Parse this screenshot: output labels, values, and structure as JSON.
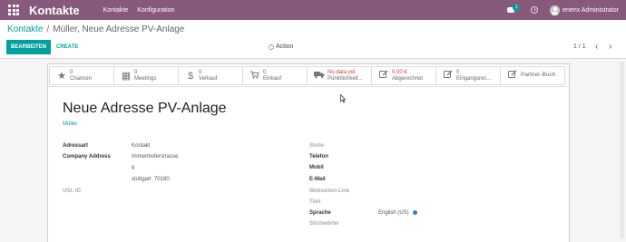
{
  "navbar": {
    "brand": "Kontakte",
    "menu": [
      "Kontakte",
      "Konfiguration"
    ],
    "chat_count": "1",
    "user_name": "enerix Administrator"
  },
  "control": {
    "breadcrumb_parent": "Kontakte",
    "breadcrumb_separator": "/",
    "breadcrumb_current": "Müller, Neue Adresse PV-Anlage",
    "edit_label": "BEARBEITEN",
    "create_label": "CREATE",
    "action_label": "Action",
    "pager": "1 / 1",
    "prev": "‹",
    "next": "›"
  },
  "stat_buttons": [
    {
      "name": "chancen",
      "icon": "star-icon",
      "glyph": "★",
      "value": "0",
      "label": "Chancen"
    },
    {
      "name": "meetings",
      "icon": "calendar-icon",
      "glyph": "▦",
      "value": "0",
      "label": "Meetings"
    },
    {
      "name": "verkauf",
      "icon": "dollar-icon",
      "glyph": "$",
      "value": "0",
      "label": "Verkauf"
    },
    {
      "name": "einkauf",
      "icon": "cart-icon",
      "glyph": "🛒",
      "value": "0",
      "label": "Einkauf"
    },
    {
      "name": "puenktlichkeit",
      "icon": "truck-icon",
      "glyph": "⛟",
      "value": "No data yet",
      "label": "Pünktlichkeit..."
    },
    {
      "name": "abgerechnet",
      "icon": "pencil-square-icon",
      "glyph": "✎",
      "value": "0,00 €",
      "label": "Abgerechnet"
    },
    {
      "name": "eingangsrechnungen",
      "icon": "pencil-square-icon",
      "glyph": "✎",
      "value": "0",
      "label": "Eingangsrec..."
    },
    {
      "name": "partner-buch",
      "icon": "pencil-square-icon",
      "glyph": "✎",
      "value": "",
      "label": "Partner-Buch"
    }
  ],
  "form": {
    "title": "Neue Adresse PV-Anlage",
    "parent": "Müller",
    "left": {
      "adressart_label": "Adressart",
      "adressart_value": "Kontakt",
      "address_label": "Company Address",
      "street": "Immenhoferstrasse",
      "street2": "9",
      "city": "stuttgart",
      "zip": "70180",
      "vat_label": "USt.-ID"
    },
    "right": {
      "stelle_label": "Stelle",
      "telefon_label": "Telefon",
      "mobil_label": "Mobil",
      "email_label": "E-Mail",
      "website_label": "Webseiten-Link",
      "titel_label": "Titel",
      "sprache_label": "Sprache",
      "sprache_value": "English (US)",
      "stichwoerter_label": "Stichwörter"
    }
  }
}
